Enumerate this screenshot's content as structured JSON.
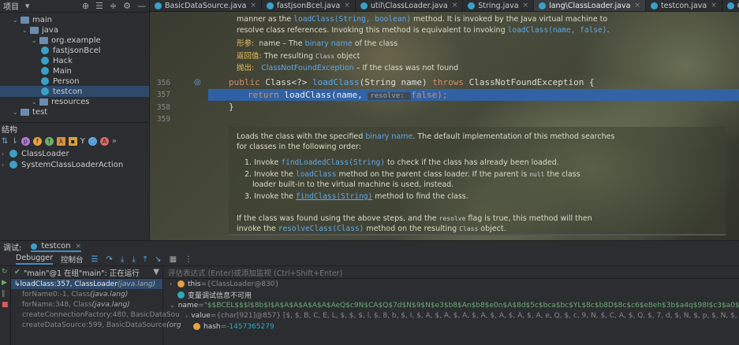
{
  "project": {
    "title": "项目",
    "tree": [
      {
        "label": "main",
        "depth": 1,
        "type": "folder"
      },
      {
        "label": "java",
        "depth": 2,
        "type": "folder"
      },
      {
        "label": "org.example",
        "depth": 3,
        "type": "folder"
      },
      {
        "label": "fastjsonBcel",
        "depth": 4,
        "type": "class"
      },
      {
        "label": "Hack",
        "depth": 4,
        "type": "class"
      },
      {
        "label": "Main",
        "depth": 4,
        "type": "class"
      },
      {
        "label": "Person",
        "depth": 4,
        "type": "class"
      },
      {
        "label": "testcon",
        "depth": 4,
        "type": "class",
        "selected": true
      },
      {
        "label": "resources",
        "depth": 3,
        "type": "folder"
      },
      {
        "label": "test",
        "depth": 1,
        "type": "folder"
      }
    ]
  },
  "structure": {
    "title": "结构",
    "items": [
      "ClassLoader",
      "SystemClassLoaderAction"
    ]
  },
  "tabs": [
    {
      "label": "BasicDataSource.java"
    },
    {
      "label": "fastjsonBcel.java"
    },
    {
      "label": "util\\ClassLoader.java"
    },
    {
      "label": "String.java"
    },
    {
      "label": "lang\\ClassLoader.java",
      "active": true
    },
    {
      "label": "testcon.java"
    },
    {
      "label": "Class.java"
    },
    {
      "label": "DefaultJSONPa"
    }
  ],
  "editor": {
    "doc_top": {
      "l1a": "manner as the ",
      "l1b": "loadClass(String, boolean)",
      "l1c": " method. It is invoked by the Java virtual machine to",
      "l2a": "resolve class references. Invoking this method is equivalent to invoking ",
      "l2b": "loadClass(name, false)",
      "l2c": ".",
      "p_label": "形参:",
      "p_text": "name – The ",
      "p_link": "binary name",
      "p_text2": " of the class",
      "r_label": "返回值:",
      "r_text": "The resulting ",
      "r_code": "Class",
      "r_text2": " object",
      "t_label": "抛出:",
      "t_link": "ClassNotFoundException",
      "t_text": " – If the class was not found"
    },
    "lines": [
      "356",
      "357",
      "358",
      "359"
    ],
    "code1": {
      "kw1": "public ",
      "t1": "Class<?> ",
      "fn": "loadClass",
      "t2": "(String name) ",
      "kw2": "throws ",
      "t3": "ClassNotFoundException {"
    },
    "code2": {
      "kw": "return ",
      "fn": "loadClass",
      "a": "(name, ",
      "hint": "resolve: ",
      "b": "false);"
    },
    "code3": "}",
    "doc_pop": {
      "d1a": "Loads the class with the specified ",
      "d1b": "binary name",
      "d1c": ". The default implementation of this method searches",
      "d2": "for classes in the following order:",
      "i1a": "1. Invoke ",
      "i1b": "findLoadedClass(String)",
      "i1c": " to check if the class has already been loaded.",
      "i2a": "2. Invoke the ",
      "i2b": "loadClass",
      "i2c": " method on the parent class loader. If the parent is ",
      "i2d": "null",
      "i2e": " the class",
      "i2f": "loader built-in to the virtual machine is used, instead.",
      "i3a": "3. Invoke the ",
      "i3b": "findClass(String)",
      "i3c": " method to find the class.",
      "e1a": "If the class was found using the above steps, and the ",
      "e1b": "resolve",
      "e1c": " flag is true, this method will then",
      "e2a": "invoke the ",
      "e2b": "resolveClass(Class)",
      "e2c": " method on the resulting ",
      "e2d": "Class",
      "e2e": " object."
    }
  },
  "debug": {
    "title": "调试:",
    "config": "testcon",
    "tabs": [
      "Debugger",
      "控制台"
    ],
    "thread": "\"main\"@1 在组\"main\": 正在运行",
    "frames": [
      {
        "a": "loadClass:357, ClassLoader ",
        "b": "(java.lang)",
        "current": true
      },
      {
        "a": "forName0:-1, Class ",
        "b": "(java.lang)"
      },
      {
        "a": "forName:348, Class ",
        "b": "(java.lang)"
      },
      {
        "a": "createConnectionFactory:480, BasicDataSou",
        "": ""
      },
      {
        "a": "createDataSource:599, BasicDataSource ",
        "b": "(org"
      }
    ],
    "eval_placeholder": "评估表达式 (Enter)或添加监视 (Ctrl+Shift+Enter)",
    "vars": [
      {
        "n": "this",
        "eq": " = ",
        "v": "{ClassLoader@830}"
      },
      {
        "n": "",
        "eq": "",
        "v": "变量调试信息不可用"
      },
      {
        "n": "name",
        "eq": " = ",
        "v": "\"$$BCEL$$$l$8b$I$A$A$A$A$A$A$AeQ$c9N$CA$Q$7d$N$9$N$e3$b8$An$b8$e0n$A$8d$5c$bca$bc$YL$8c$b8D$8c$c6$e8eh$3b$a4q$98I$c3$a0$f91g$_hLf4$D$"
      },
      {
        "n": "value",
        "eq": " = ",
        "v": "{char[921]@857} [$, $, B, C, E, L, $, $, $, l, $, 8, b, $, I, $, A, $, A, $, A, $, A, $, A, $, A, $, A, e, Q, $, c, 9, N, $, C, A, $, Q, $, 7, d, $, N, $, p, $, N, $, e, 3, $, b, 8, $, A, n, $, b, 8, $, e"
      },
      {
        "n": "hash",
        "eq": " = ",
        "v": "-1457365279"
      }
    ]
  },
  "colors": {
    "accent": "#2f64b0",
    "keyword": "#cf8e6d",
    "method": "#56a8f5",
    "string": "#6aab73"
  }
}
